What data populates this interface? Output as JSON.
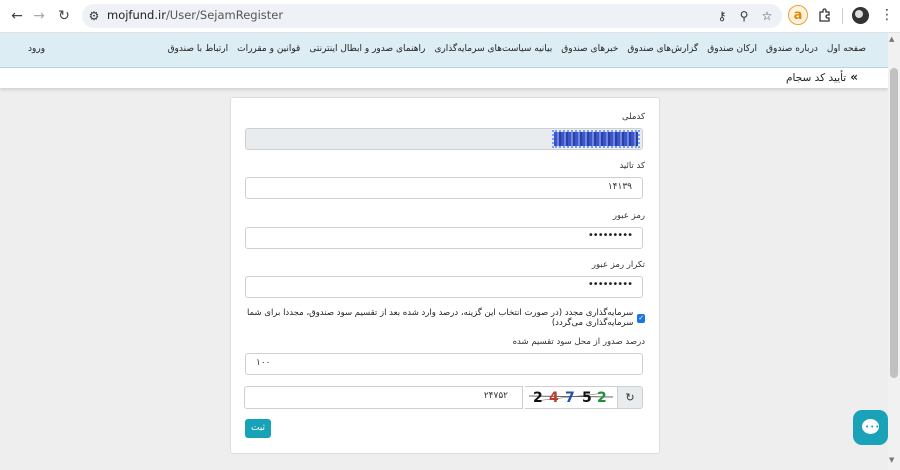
{
  "browser": {
    "url_host": "mojfund.ir",
    "url_path": "/User/SejamRegister",
    "extension_letter": "a"
  },
  "site_nav": {
    "menu": [
      "صفحه اول",
      "درباره صندوق",
      "ارکان صندوق",
      "گزارش‌های صندوق",
      "خبرهای صندوق",
      "بیانیه سیاست‌های سرمایه‌گذاری",
      "راهنمای صدور و ابطال اینترنتی",
      "قوانین و مقررات",
      "ارتباط با صندوق"
    ],
    "login": "ورود"
  },
  "breadcrumb": {
    "arrow": "»",
    "title": "تأیید کد سجام"
  },
  "form": {
    "national_code_label": "کدملی",
    "confirm_code_label": "کد تائید",
    "confirm_code_value": "۱۴۱۳۹",
    "password_label": "رمز عبور",
    "password_value": "•••••••••",
    "password_repeat_label": "تکرار رمز عبور",
    "password_repeat_value": "•••••••••",
    "reinvest_text": "سرمایه‌گذاری مجدد (در صورت انتخاب این گزینه، درصد وارد شده بعد از تقسیم سود صندوق، مجددا برای شما سرمایه‌گذاری می‌گردد)",
    "reinvest_checked": true,
    "percent_label": "درصد صدور از محل سود تقسیم شده",
    "percent_value": "۱۰۰",
    "captcha_input_value": "۲۴۷۵۲",
    "captcha_digits": [
      "2",
      "4",
      "7",
      "5",
      "2"
    ],
    "captcha_colors": [
      "#111111",
      "#c0392b",
      "#1e4fb3",
      "#111111",
      "#1e8f3a"
    ],
    "submit_label": "ثبت"
  },
  "colors": {
    "accent": "#17a2b8",
    "nav_bg": "#dcedf4",
    "chat_button": "#1aa3b8"
  }
}
